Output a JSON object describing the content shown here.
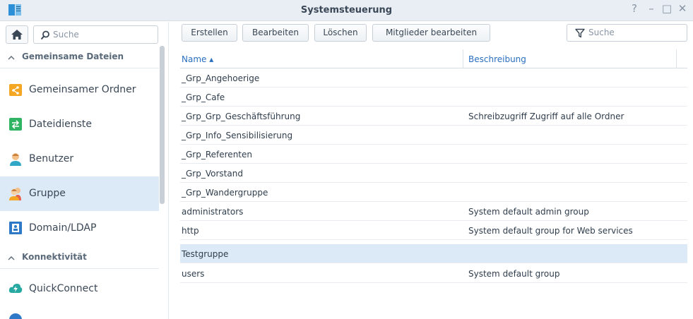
{
  "window": {
    "title": "Systemsteuerung",
    "help_glyph": "?",
    "minimize_glyph": "–",
    "maximize_glyph": "□",
    "close_glyph": "✕"
  },
  "sidebar": {
    "search_placeholder": "Suche",
    "sections": [
      {
        "label": "Gemeinsame Dateien",
        "chevron": "^"
      },
      {
        "label": "Konnektivität",
        "chevron": "^"
      }
    ],
    "items": [
      {
        "label": "Gemeinsamer Ordner",
        "icon": "shared-folder-icon",
        "active": false
      },
      {
        "label": "Dateidienste",
        "icon": "file-services-icon",
        "active": false
      },
      {
        "label": "Benutzer",
        "icon": "user-icon",
        "active": false
      },
      {
        "label": "Gruppe",
        "icon": "group-icon",
        "active": true
      },
      {
        "label": "Domain/LDAP",
        "icon": "domain-ldap-icon",
        "active": false
      },
      {
        "label": "QuickConnect",
        "icon": "quickconnect-icon",
        "active": false
      }
    ]
  },
  "toolbar": {
    "create_label": "Erstellen",
    "edit_label": "Bearbeiten",
    "delete_label": "Löschen",
    "edit_members_label": "Mitglieder bearbeiten",
    "search_placeholder": "Suche"
  },
  "table": {
    "columns": {
      "name": "Name ▴",
      "description": "Beschreibung"
    },
    "rows": [
      {
        "name": "_Grp_Angehoerige",
        "description": ""
      },
      {
        "name": "_Grp_Cafe",
        "description": ""
      },
      {
        "name": "_Grp_Grp_Geschäftsführung",
        "description": "Schreibzugriff Zugriff auf alle Ordner"
      },
      {
        "name": "_Grp_Info_Sensibilisierung",
        "description": ""
      },
      {
        "name": "_Grp_Referenten",
        "description": ""
      },
      {
        "name": "_Grp_Vorstand",
        "description": ""
      },
      {
        "name": "_Grp_Wandergruppe",
        "description": ""
      },
      {
        "name": "administrators",
        "description": "System default admin group"
      },
      {
        "name": "http",
        "description": "System default group for Web services"
      },
      {
        "name": "Testgruppe",
        "description": "",
        "selected": true
      },
      {
        "name": "users",
        "description": "System default group"
      }
    ]
  },
  "colors": {
    "accent": "#2a6fbf",
    "selection": "#dce9f7",
    "titlebar": "#e9eef4"
  }
}
